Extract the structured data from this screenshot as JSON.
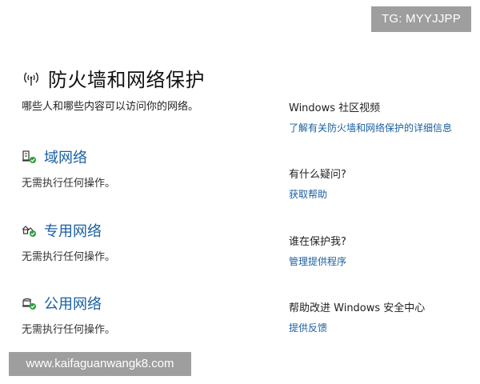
{
  "badge": "TG: MYYJJPP",
  "page": {
    "title": "防火墙和网络保护",
    "subtitle": "哪些人和哪些内容可以访问你的网络。"
  },
  "networks": [
    {
      "name": "域网络",
      "status": "无需执行任何操作。",
      "icon": "domain-network-icon"
    },
    {
      "name": "专用网络",
      "status": "无需执行任何操作。",
      "icon": "private-network-icon"
    },
    {
      "name": "公用网络",
      "status": "无需执行任何操作。",
      "icon": "public-network-icon"
    }
  ],
  "side": {
    "video": {
      "heading": "Windows 社区视频",
      "link": "了解有关防火墙和网络保护的详细信息"
    },
    "question": {
      "heading": "有什么疑问?",
      "link": "获取帮助"
    },
    "protect": {
      "heading": "谁在保护我?",
      "link": "管理提供程序"
    },
    "improve": {
      "heading": "帮助改进 Windows 安全中心",
      "link": "提供反馈"
    }
  },
  "watermark": "www.kaifaguanwangk8.com",
  "colors": {
    "link": "#1a5fa0",
    "ok_green": "#2e9e3a",
    "badge_bg": "#9e9e9e"
  }
}
